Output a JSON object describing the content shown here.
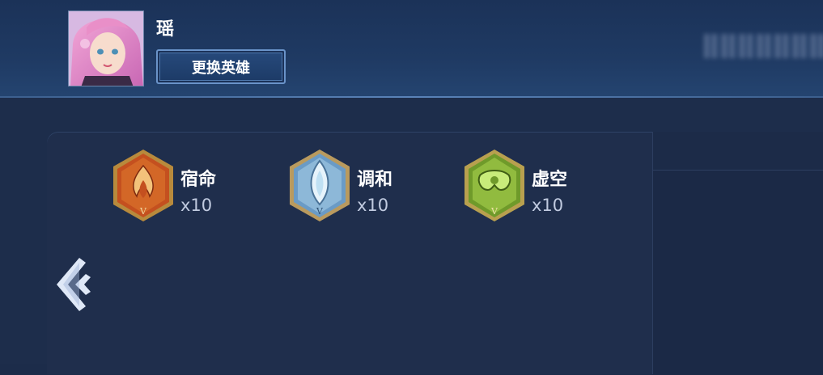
{
  "hero": {
    "name": "瑶",
    "change_label": "更换英雄"
  },
  "runes": [
    {
      "name": "宿命",
      "count": "x10",
      "icon": "fire-rune-icon",
      "color": "#c24a1a"
    },
    {
      "name": "调和",
      "count": "x10",
      "icon": "water-rune-icon",
      "color": "#7fb0d8"
    },
    {
      "name": "虚空",
      "count": "x10",
      "icon": "void-rune-icon",
      "color": "#7fb330"
    }
  ],
  "navigation": {
    "back_icon": "back-arrow-icon"
  },
  "colors": {
    "accent": "#6a93c9",
    "background": "#1c2c4a"
  }
}
